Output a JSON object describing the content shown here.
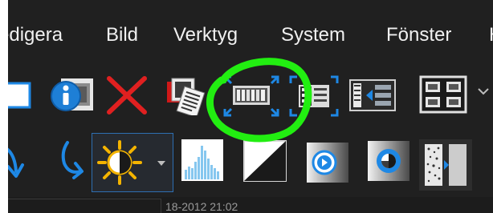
{
  "menu": {
    "items": [
      {
        "label": "edigera"
      },
      {
        "label": "Bild"
      },
      {
        "label": "Verktyg"
      },
      {
        "label": "System"
      },
      {
        "label": "Fönster"
      },
      {
        "label": "H"
      }
    ]
  },
  "toolbar_top": {
    "buttons": [
      {
        "icon": "blue-square-icon"
      },
      {
        "icon": "info-icon"
      },
      {
        "icon": "delete-x-icon"
      },
      {
        "icon": "image-stack-icon"
      },
      {
        "icon": "expand-panorama-icon"
      },
      {
        "icon": "expand-image-list-icon"
      },
      {
        "icon": "image-list-layout-icon"
      },
      {
        "icon": "grid-2x2-layout-icon"
      }
    ],
    "more_icon": "chevron-down-icon"
  },
  "toolbar_bottom": {
    "buttons": [
      {
        "icon": "undo-arrow-icon"
      },
      {
        "icon": "redo-arrow-icon"
      },
      {
        "icon": "brightness-contrast-icon"
      },
      {
        "icon": "histogram-icon"
      },
      {
        "icon": "invert-diagonal-icon"
      },
      {
        "icon": "gamma-circle-icon"
      },
      {
        "icon": "contrast-circle-icon"
      },
      {
        "icon": "noise-filter-icon"
      }
    ]
  },
  "colors": {
    "background": "#202020",
    "menu_text": "#f0f0f0",
    "accent_blue": "#1e88e5",
    "highlight_green": "#22ee11",
    "delete_red": "#e02020",
    "sun_yellow": "#f4b400"
  },
  "status": {
    "text": "18-2012 21:02"
  }
}
